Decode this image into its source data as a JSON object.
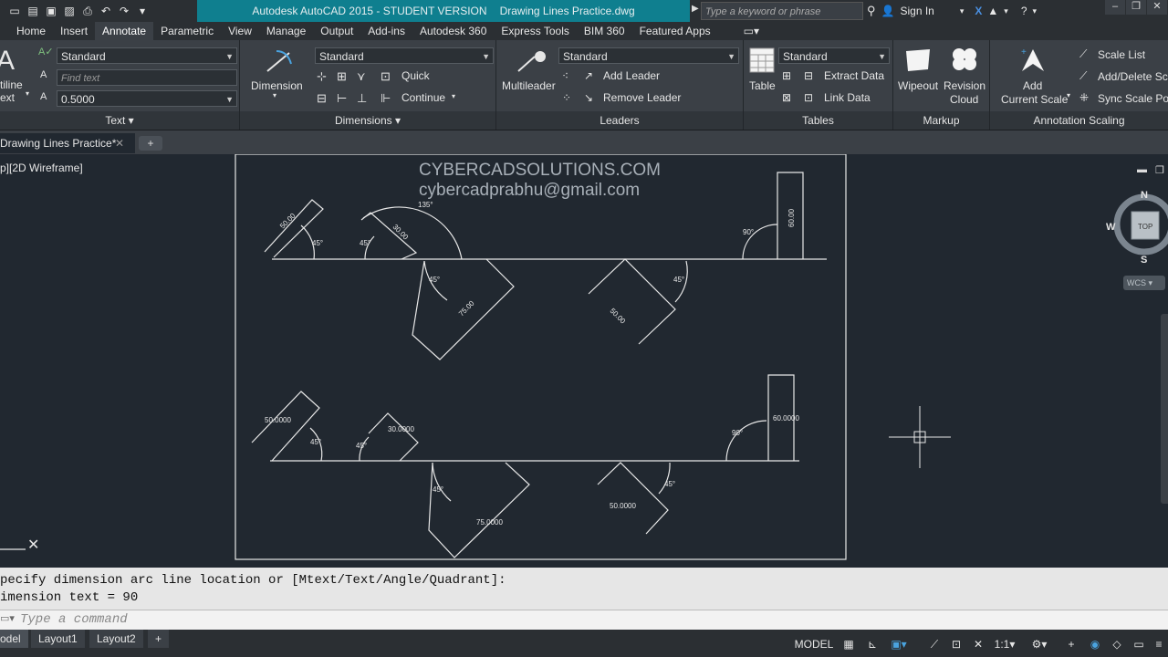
{
  "window": {
    "app_title": "Autodesk AutoCAD 2015 - STUDENT VERSION",
    "file_title": "Drawing Lines Practice.dwg",
    "search_placeholder": "Type a keyword or phrase",
    "sign_in": "Sign In"
  },
  "menu_tabs": [
    "Home",
    "Insert",
    "Annotate",
    "Parametric",
    "View",
    "Manage",
    "Output",
    "Add-ins",
    "Autodesk 360",
    "Express Tools",
    "BIM 360",
    "Featured Apps"
  ],
  "active_tab": "Annotate",
  "ribbon": {
    "text_panel": {
      "title": "Text",
      "multiline_label_1": "tiline",
      "multiline_label_2": "ext",
      "style": "Standard",
      "find_placeholder": "Find text",
      "height": "0.5000"
    },
    "dimensions_panel": {
      "title": "Dimensions",
      "dimension_label": "Dimension",
      "style": "Standard",
      "quick": "Quick",
      "continue": "Continue"
    },
    "leaders_panel": {
      "title": "Leaders",
      "multileader_label": "Multileader",
      "style": "Standard",
      "add_leader": "Add Leader",
      "remove_leader": "Remove Leader"
    },
    "tables_panel": {
      "title": "Tables",
      "table_label": "Table",
      "style": "Standard",
      "extract_data": "Extract Data",
      "link_data": "Link Data"
    },
    "markup_panel": {
      "title": "Markup",
      "wipeout": "Wipeout",
      "revision_1": "Revision",
      "revision_2": "Cloud"
    },
    "scaling_panel": {
      "title": "Annotation Scaling",
      "add_1": "Add",
      "add_2": "Current Scale",
      "scale_list": "Scale List",
      "add_delete": "Add/Delete Sca",
      "sync": "Sync Scale Pos"
    }
  },
  "file_tab": "Drawing Lines Practice*",
  "viewport_label": "p][2D Wireframe]",
  "watermark": {
    "line1": "CYBERCADSOLUTIONS.COM",
    "line2": "cybercadprabhu@gmail.com"
  },
  "drawing_labels": {
    "top_row": {
      "d1": "50.00",
      "a1": "45°",
      "a2": "45°",
      "d2": "30.00",
      "arc": "135°",
      "a3": "45°",
      "d3": "75.00",
      "d4": "50.00",
      "a4": "45°",
      "a5": "90°",
      "d5": "60.00"
    },
    "bottom_row": {
      "d1": "50.0000",
      "a1": "45°",
      "a2": "45°",
      "d2": "30.0000",
      "a3": "45°",
      "d3": "75.0000",
      "d4": "50.0000",
      "a4": "45°",
      "a5": "90°",
      "d5": "60.0000"
    }
  },
  "viewcube": {
    "n": "N",
    "s": "S",
    "w": "W",
    "top": "TOP",
    "wcs": "WCS"
  },
  "command_history": [
    "pecify dimension arc line location or [Mtext/Text/Angle/Quadrant]:",
    "imension text = 90"
  ],
  "command_placeholder": "Type a command",
  "layout_tabs": [
    "odel",
    "Layout1",
    "Layout2"
  ],
  "status": {
    "model": "MODEL",
    "scale": "1:1"
  }
}
